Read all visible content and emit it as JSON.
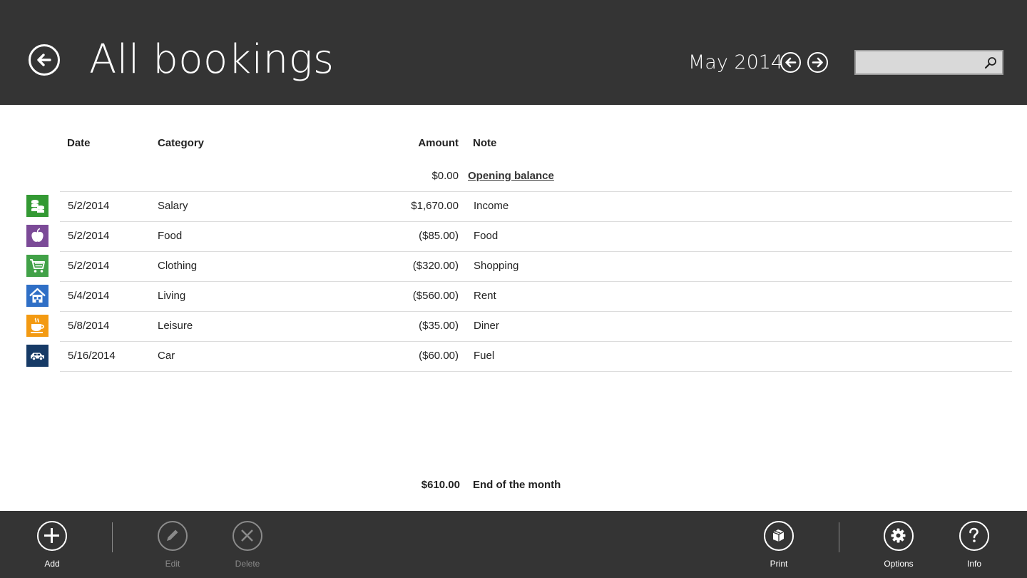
{
  "header": {
    "title": "All bookings",
    "month": "May 2014",
    "search_placeholder": ""
  },
  "columns": {
    "date": "Date",
    "category": "Category",
    "amount": "Amount",
    "note": "Note"
  },
  "opening": {
    "amount": "$0.00",
    "label": "Opening balance"
  },
  "bookings": [
    {
      "icon": "money-coins-icon",
      "color": "#339933",
      "date": "5/2/2014",
      "category": "Salary",
      "amount": "$1,670.00",
      "note": "Income"
    },
    {
      "icon": "apple-icon",
      "color": "#7b4a97",
      "date": "5/2/2014",
      "category": "Food",
      "amount": "($85.00)",
      "note": "Food"
    },
    {
      "icon": "shopping-cart-icon",
      "color": "#41a147",
      "date": "5/2/2014",
      "category": "Clothing",
      "amount": "($320.00)",
      "note": "Shopping"
    },
    {
      "icon": "house-icon",
      "color": "#2f6fc6",
      "date": "5/4/2014",
      "category": "Living",
      "amount": "($560.00)",
      "note": "Rent"
    },
    {
      "icon": "coffee-cup-icon",
      "color": "#f39a12",
      "date": "5/8/2014",
      "category": "Leisure",
      "amount": "($35.00)",
      "note": "Diner"
    },
    {
      "icon": "car-icon",
      "color": "#163a66",
      "date": "5/16/2014",
      "category": "Car",
      "amount": "($60.00)",
      "note": "Fuel"
    }
  ],
  "summary": {
    "amount": "$610.00",
    "label": "End of the month"
  },
  "appbar": {
    "add": "Add",
    "edit": "Edit",
    "delete": "Delete",
    "print": "Print",
    "options": "Options",
    "info": "Info"
  }
}
